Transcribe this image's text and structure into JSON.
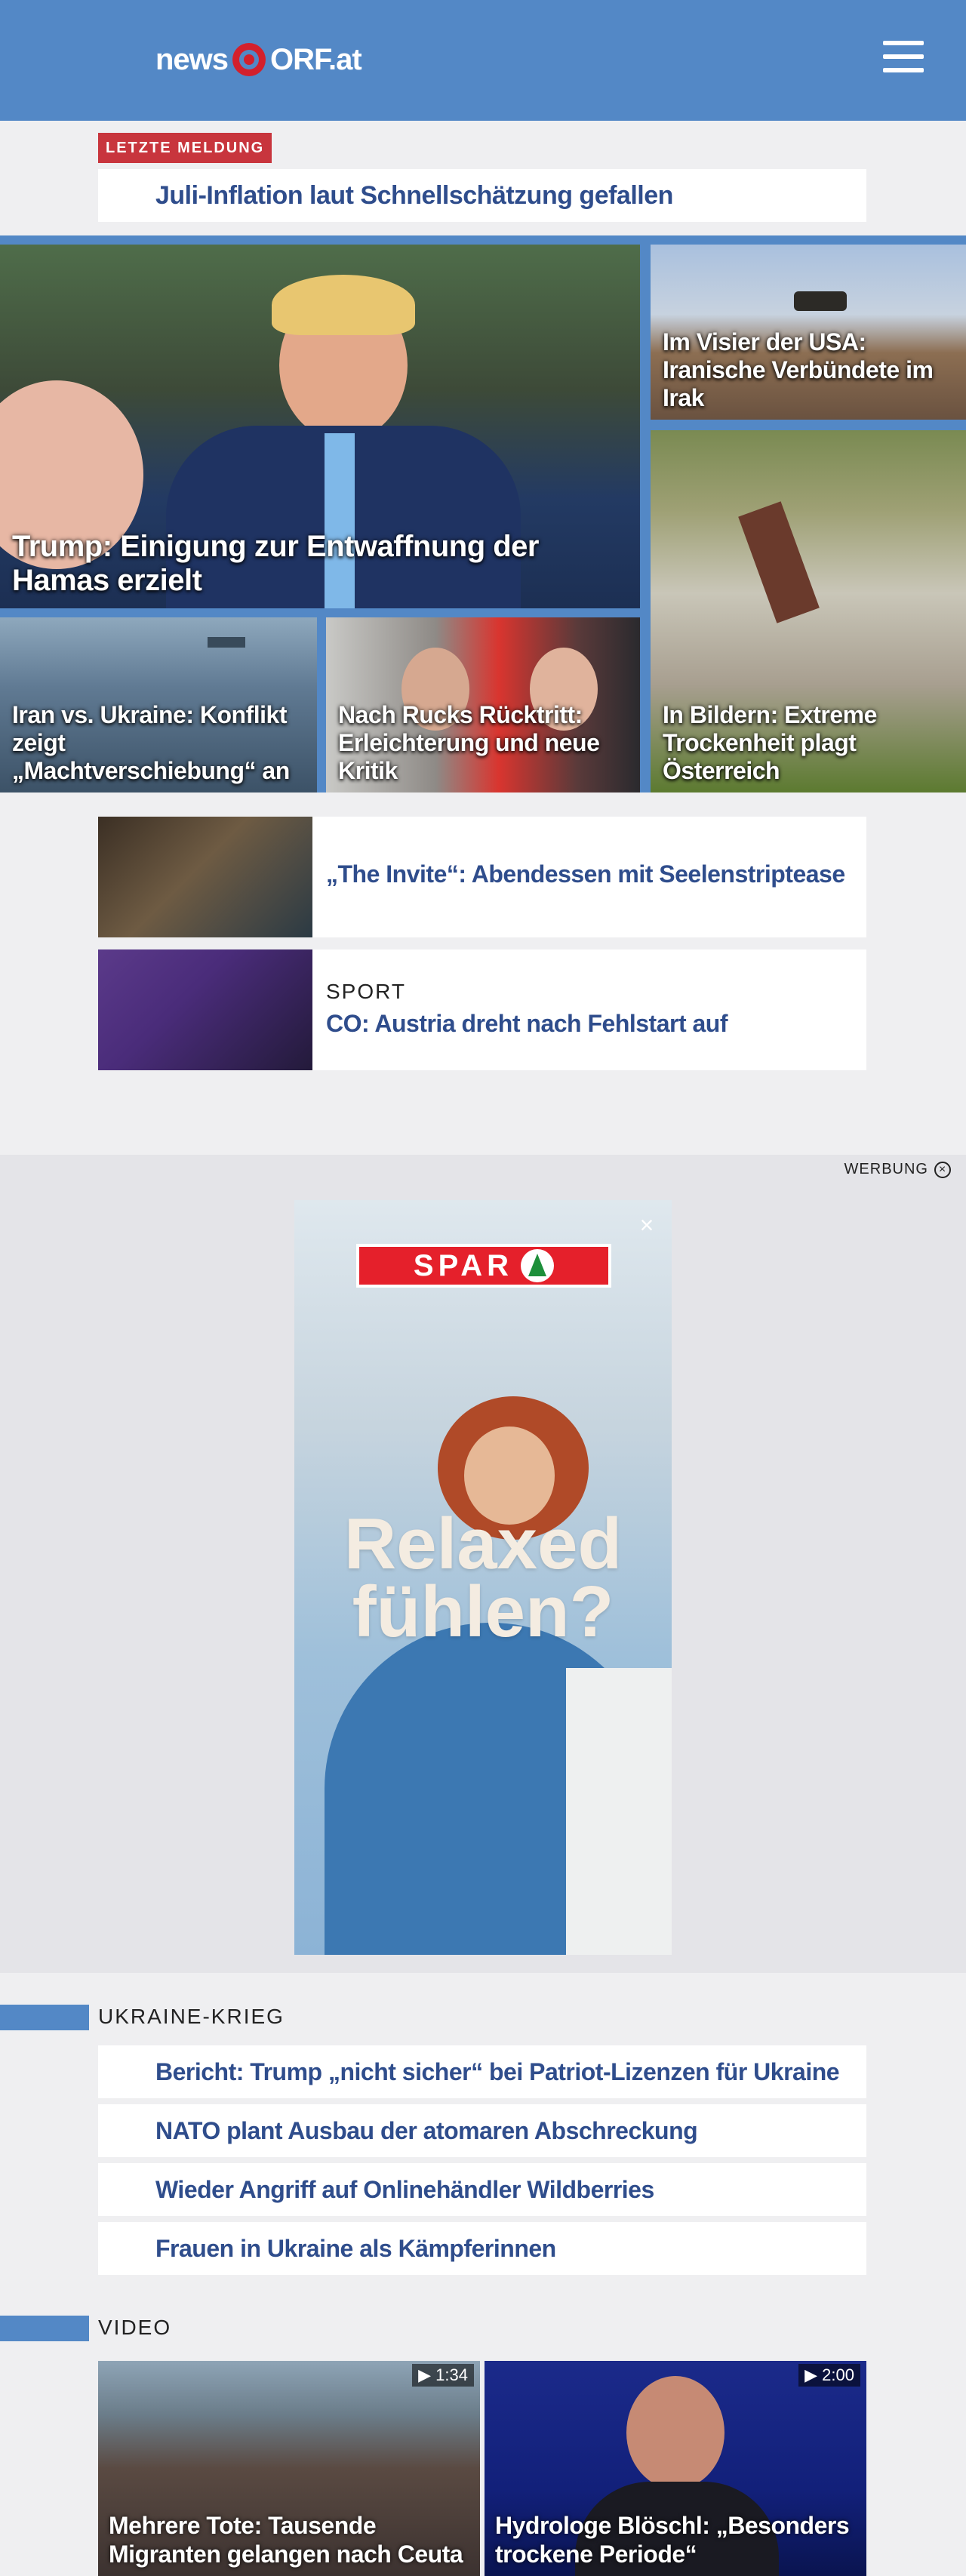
{
  "header": {
    "logo_news": "news",
    "logo_orf": "ORF.at",
    "menu_icon": "hamburger-menu-icon"
  },
  "breaking": {
    "badge": "LETZTE MELDUNG",
    "headline": "Juli-Inflation laut Schnellschätzung gefallen"
  },
  "top_stories": {
    "main": "Trump: Einigung zur Entwaffnung der Hamas erzielt",
    "irak": "Im Visier der USA: Iranische Verbündete im Irak",
    "dry": "In Bildern: Extreme Trockenheit plagt Österreich",
    "iran": "Iran vs. Ukraine: Konflikt zeigt „Machtverschiebung“ an",
    "ruck": "Nach Rucks Rücktritt: Erleichterung und neue Kritik"
  },
  "stories": [
    {
      "title": "„The Invite“: Abendessen mit Seelenstriptease"
    },
    {
      "kicker": "SPORT",
      "title": "CO: Austria dreht nach Fehlstart auf"
    }
  ],
  "ad": {
    "label": "WERBUNG",
    "brand": "SPAR",
    "headline_line1": "Relaxed",
    "headline_line2": "fühlen?"
  },
  "ukraine": {
    "section": "UKRAINE-KRIEG",
    "items": [
      "Bericht: Trump „nicht sicher“ bei Patriot-Lizenzen für Ukraine",
      "NATO plant Ausbau der atomaren Abschreckung",
      "Wieder Angriff auf Onlinehändler Wildberries",
      "Frauen in Ukraine als Kämpferinnen"
    ]
  },
  "video": {
    "section": "VIDEO",
    "items": [
      {
        "duration": "1:34",
        "title": "Mehrere Tote: Tausende Migranten gelangen nach Ceuta"
      },
      {
        "duration": "2:00",
        "title": "Hydrologe Blöschl: „Besonders trockene Periode“"
      }
    ]
  }
}
